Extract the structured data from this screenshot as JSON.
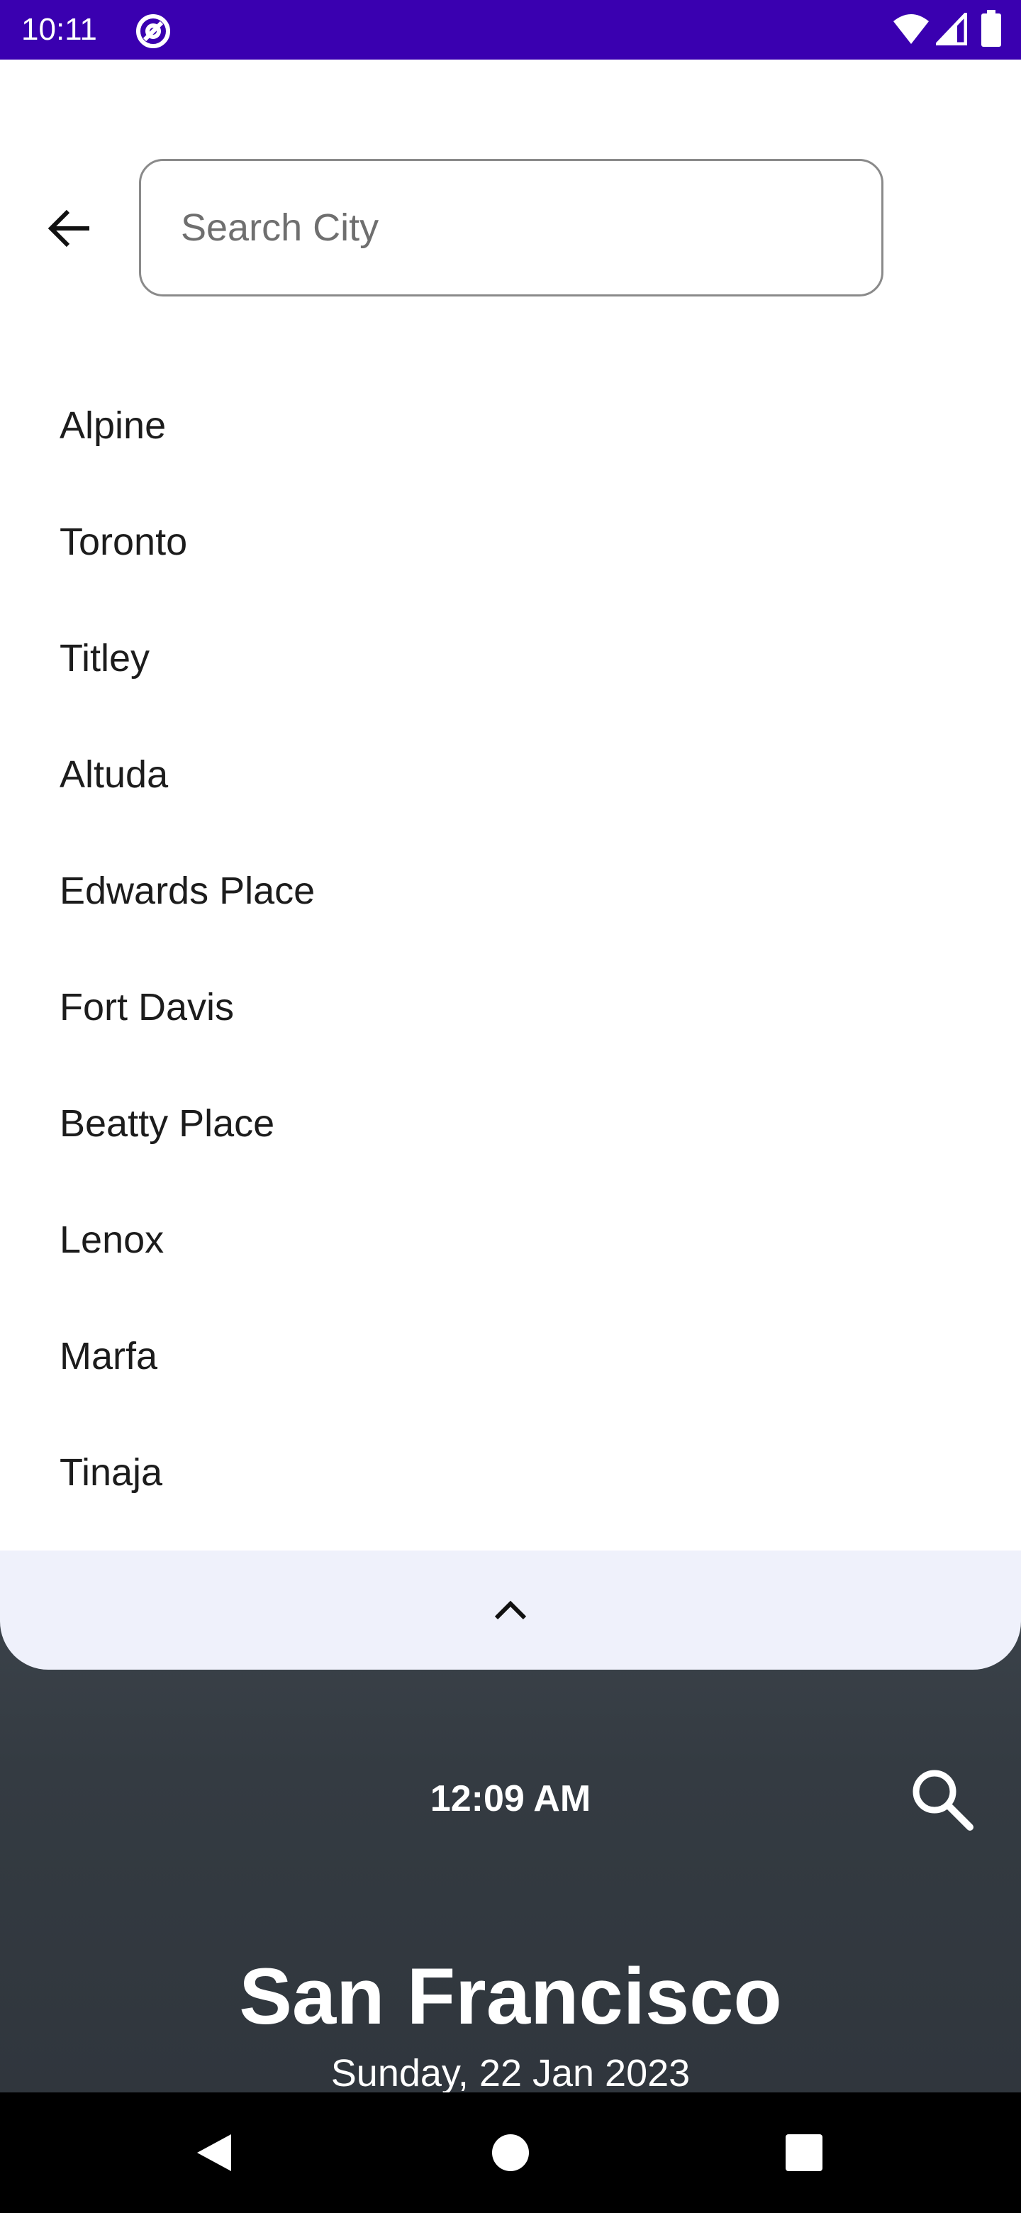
{
  "status_bar": {
    "time": "10:11",
    "icons": [
      "at-sign-icon",
      "wifi-icon",
      "signal-icon",
      "battery-icon"
    ]
  },
  "search": {
    "placeholder": "Search City",
    "value": ""
  },
  "cities": [
    "Alpine",
    "Toronto",
    "Titley",
    "Altuda",
    "Edwards Place",
    "Fort Davis",
    "Beatty Place",
    "Lenox",
    "Marfa",
    "Tinaja"
  ],
  "weather": {
    "time": "12:09 AM",
    "city": "San Francisco",
    "date": "Sunday, 22 Jan 2023"
  },
  "colors": {
    "status_bar": "#3a00b0",
    "sheet": "#eff1fb",
    "nav_bar": "#000000"
  }
}
